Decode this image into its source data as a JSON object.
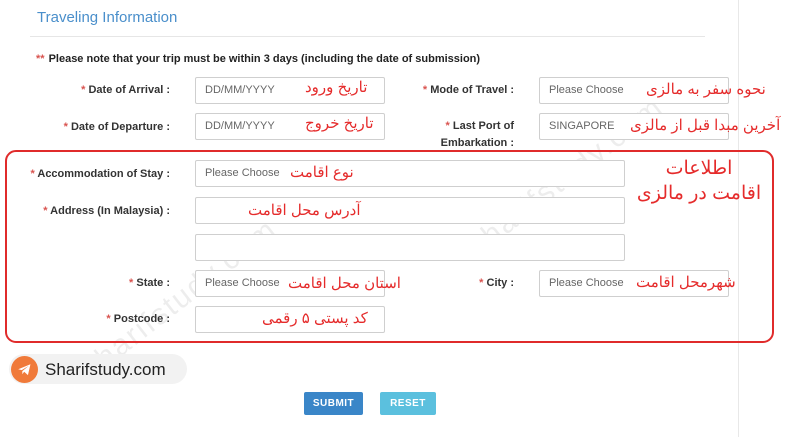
{
  "section_title": "Traveling Information",
  "note": {
    "star": "**",
    "text": "Please note that your trip must be within 3 days (including the date of submission)"
  },
  "required_mark": "*",
  "fields": {
    "date_of_arrival": {
      "label": "Date of Arrival :",
      "placeholder": "DD/MM/YYYY",
      "annotation": "تاریخ ورود"
    },
    "date_of_departure": {
      "label": "Date of Departure :",
      "placeholder": "DD/MM/YYYY",
      "annotation": "تاریخ خروج"
    },
    "mode_of_travel": {
      "label": "Mode of Travel :",
      "value": "Please Choose",
      "annotation": "نحوه سفر به مالزی"
    },
    "last_port": {
      "label_line1": "Last Port of",
      "label_line2": "Embarkation :",
      "value": "SINGAPORE",
      "annotation": "آخرین مبدا قبل از مالزی"
    },
    "accommodation": {
      "label": "Accommodation of Stay :",
      "value": "Please Choose",
      "annotation": "نوع اقامت"
    },
    "address": {
      "label": "Address (In Malaysia) :",
      "line1_value": "",
      "line2_value": "",
      "annotation": "آدرس محل اقامت"
    },
    "state": {
      "label": "State :",
      "value": "Please Choose",
      "annotation": "استان محل اقامت"
    },
    "city": {
      "label": "City :",
      "value": "Please Choose",
      "annotation": "شهرمحل اقامت"
    },
    "postcode": {
      "label": "Postcode :",
      "value": "",
      "annotation": "کد پستی ۵ رقمی"
    }
  },
  "stay_annotation": {
    "line1": "اطلاعات",
    "line2": "اقامت در مالزی"
  },
  "watermark_text": "sharifstudy.com",
  "brand": {
    "name": "Sharifstudy.com",
    "icon": "telegram-icon"
  },
  "buttons": {
    "submit": "SUBMIT",
    "reset": "RESET"
  },
  "colors": {
    "accent_title": "#4a8fcb",
    "annotation_red": "#e52b2b",
    "submit": "#3a86c8",
    "reset": "#5bc0de",
    "brand_orange": "#f07a3a"
  }
}
